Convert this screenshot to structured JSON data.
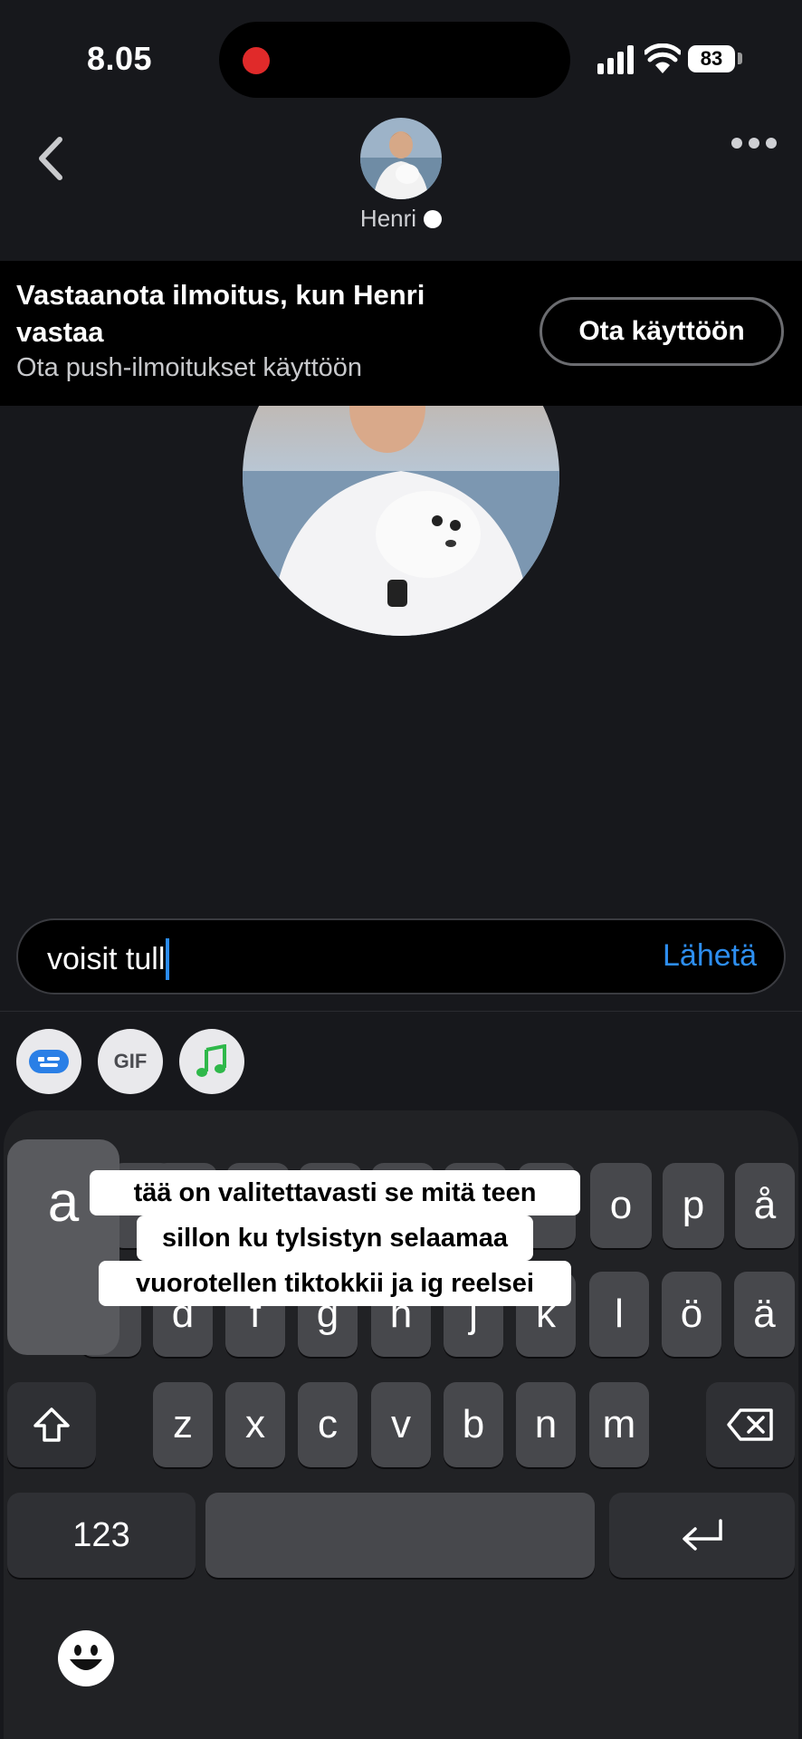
{
  "status_bar": {
    "time": "8.05",
    "battery": "83"
  },
  "header": {
    "contact_name": "Henri"
  },
  "notification_banner": {
    "title": "Vastaanota ilmoitus, kun Henri vastaa",
    "subtitle": "Ota push-ilmoitukset käyttöön",
    "button_label": "Ota käyttöön"
  },
  "composer": {
    "input_value": "voisit tull",
    "send_label": "Lähetä"
  },
  "attachments": {
    "gif_label": "GIF"
  },
  "caption_overlay": {
    "line1": "tää on valitettavasti se mitä teen",
    "line2": "sillon ku tylsistyn selaamaa",
    "line3": "vuorotellen tiktokkii ja ig reelsei"
  },
  "keyboard": {
    "row1": [
      "a",
      "o",
      "p",
      "å"
    ],
    "row2": [
      "s",
      "d",
      "f",
      "g",
      "h",
      "j",
      "k",
      "l",
      "ö",
      "ä"
    ],
    "row3": [
      "z",
      "x",
      "c",
      "v",
      "b",
      "n",
      "m"
    ],
    "numbers_label": "123"
  },
  "colors": {
    "accent": "#2d8ef0",
    "record": "#e02a2a",
    "background": "#17181c"
  }
}
